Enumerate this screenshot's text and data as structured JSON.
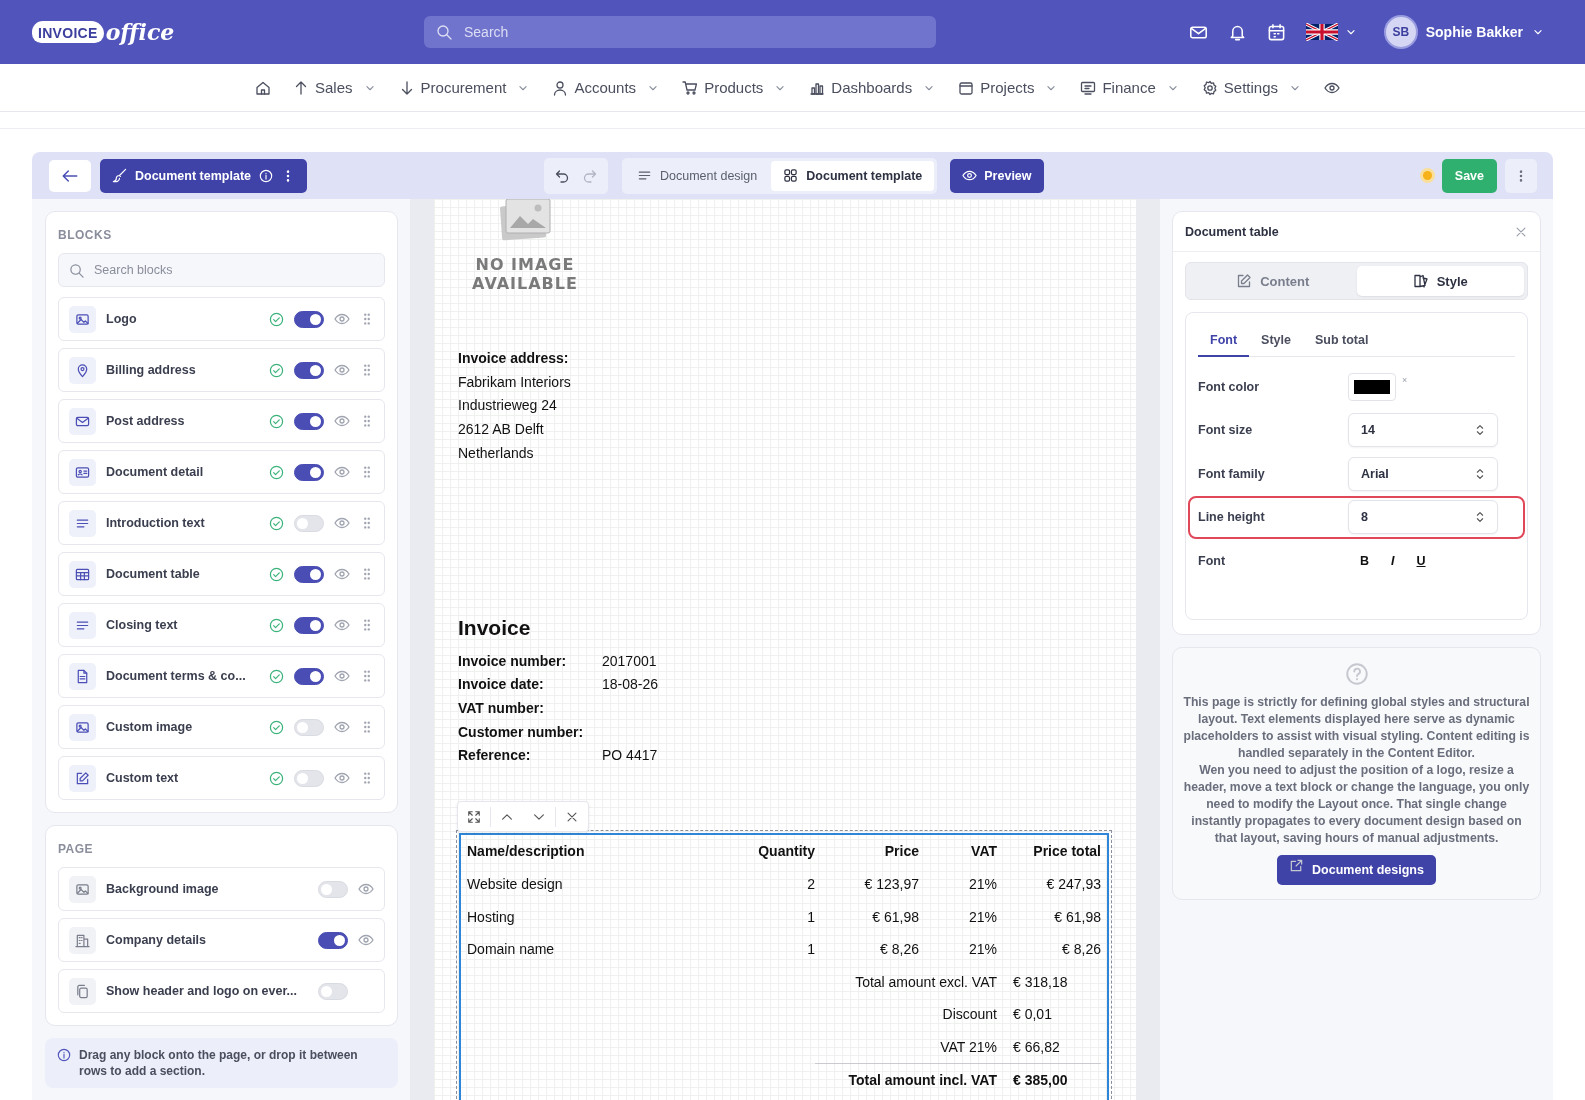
{
  "header": {
    "logo": {
      "badge": "INVOICE",
      "word": "office"
    },
    "search": {
      "placeholder": "Search"
    },
    "user": {
      "initials": "SB",
      "name": "Sophie Bakker"
    }
  },
  "nav": [
    {
      "label": "Sales"
    },
    {
      "label": "Procurement"
    },
    {
      "label": "Accounts"
    },
    {
      "label": "Products"
    },
    {
      "label": "Dashboards"
    },
    {
      "label": "Projects"
    },
    {
      "label": "Finance"
    },
    {
      "label": "Settings"
    }
  ],
  "toolbar": {
    "template_button": "Document template",
    "segments": [
      {
        "label": "Document design",
        "selected": false
      },
      {
        "label": "Document template",
        "selected": true
      }
    ],
    "preview": "Preview",
    "unsaved_changes": true,
    "save": "Save"
  },
  "blocks": {
    "title": "BLOCKS",
    "search": {
      "placeholder": "Search blocks"
    },
    "items": [
      {
        "label": "Logo",
        "on": true
      },
      {
        "label": "Billing address",
        "on": true
      },
      {
        "label": "Post address",
        "on": true
      },
      {
        "label": "Document detail",
        "on": true
      },
      {
        "label": "Introduction text",
        "on": false
      },
      {
        "label": "Document table",
        "on": true
      },
      {
        "label": "Closing text",
        "on": true
      },
      {
        "label": "Document terms & co...",
        "on": true
      },
      {
        "label": "Custom image",
        "on": false
      },
      {
        "label": "Custom text",
        "on": false
      }
    ]
  },
  "page_section": {
    "title": "PAGE",
    "items": [
      {
        "label": "Background image",
        "on": false,
        "previewable": true
      },
      {
        "label": "Company details",
        "on": true,
        "previewable": true
      },
      {
        "label": "Show header and logo on ever...",
        "on": false,
        "previewable": false
      }
    ]
  },
  "hint": "Drag any block onto the page, or drop it between rows to add a section.",
  "document": {
    "no_image": [
      "NO IMAGE",
      "AVAILABLE"
    ],
    "address_label": "Invoice address:",
    "address": [
      "Fabrikam Interiors",
      "Industrieweg 24",
      "2612 AB Delft",
      "Netherlands"
    ],
    "heading": "Invoice",
    "details": [
      {
        "label": "Invoice number:",
        "value": "2017001"
      },
      {
        "label": "Invoice date:",
        "value": "18-08-26"
      },
      {
        "label": "VAT number:"
      },
      {
        "label": "Customer number:"
      },
      {
        "label": "Reference:",
        "value": "PO 4417"
      }
    ],
    "table": {
      "columns": [
        "Name/description",
        "Quantity",
        "Price",
        "VAT",
        "Price total"
      ],
      "rows": [
        [
          "Website design",
          "2",
          "€ 123,97",
          "21%",
          "€ 247,93"
        ],
        [
          "Hosting",
          "1",
          "€ 61,98",
          "21%",
          "€ 61,98"
        ],
        [
          "Domain name",
          "1",
          "€ 8,26",
          "21%",
          "€ 8,26"
        ]
      ],
      "totals": [
        {
          "kind": "line",
          "label": "Total amount excl. VAT",
          "value": "€ 318,18"
        },
        {
          "kind": "line",
          "label": "Discount",
          "value": "€ 0,01"
        },
        {
          "kind": "line",
          "label": "VAT 21%",
          "value": "€ 66,82"
        },
        {
          "kind": "grand",
          "label": "Total amount incl. VAT",
          "value": "€ 385,00"
        }
      ]
    }
  },
  "inspector": {
    "title": "Document table",
    "tabs": [
      {
        "label": "Content",
        "selected": false
      },
      {
        "label": "Style",
        "selected": true
      }
    ],
    "subtabs": [
      {
        "label": "Font",
        "selected": true
      },
      {
        "label": "Style",
        "selected": false
      },
      {
        "label": "Sub total",
        "selected": false
      }
    ],
    "fields": [
      {
        "kind": "color",
        "label": "Font color",
        "color": "#000000",
        "clear": "×",
        "highlighted": false
      },
      {
        "kind": "select",
        "label": "Font size",
        "value": "14",
        "highlighted": false
      },
      {
        "kind": "select",
        "label": "Font family",
        "value": "Arial",
        "highlighted": false
      },
      {
        "kind": "select",
        "label": "Line height",
        "value": "8",
        "highlighted": true
      },
      {
        "kind": "styles",
        "label": "Font",
        "buttons": [
          {
            "kind": "bold",
            "label": "B"
          },
          {
            "kind": "italic",
            "label": "I"
          },
          {
            "kind": "underline",
            "label": "U"
          }
        ],
        "highlighted": false
      }
    ]
  },
  "help": {
    "paragraphs": [
      "This page is strictly for defining global styles and structural layout. Text elements displayed here serve as dynamic placeholders to assist with visual styling. Content editing is handled separately in the Content Editor.",
      "Wen you need to adjust the position of a logo, resize a header, move a text block or change the language, you only need to modify the Layout once. That single change instantly propagates to every document design based on that layout, saving hours of manual adjustments."
    ],
    "button": "Document designs"
  }
}
